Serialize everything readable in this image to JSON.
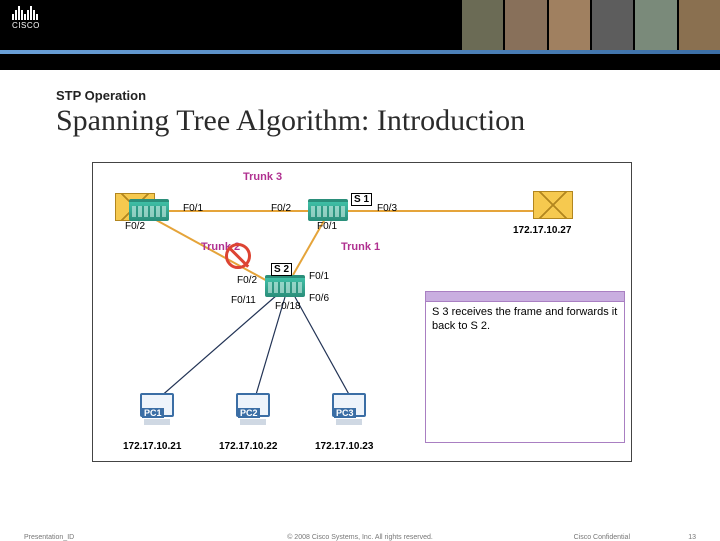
{
  "header": {
    "logo_text": "CISCO"
  },
  "super_title": "STP Operation",
  "title": "Spanning Tree Algorithm: Introduction",
  "diagram": {
    "trunks": {
      "t1": "Trunk 1",
      "t2": "Trunk 2",
      "t3": "Trunk 3"
    },
    "switches": {
      "s1": "S 1",
      "s2": "S 2"
    },
    "ports": {
      "s1_f01_left": "F0/1",
      "s1_f02_in": "F0/2",
      "s1_f01_down": "F0/1",
      "s1_f03": "F0/3",
      "s3_f02": "F0/2",
      "s2_f02": "F0/2",
      "s2_f01": "F0/1",
      "s2_f011": "F0/11",
      "s2_f018": "F0/18",
      "s2_f06": "F0/6"
    },
    "pcs": {
      "pc1": "PC1",
      "pc2": "PC2",
      "pc3": "PC3"
    },
    "ips": {
      "pc1": "172.17.10.21",
      "pc2": "172.17.10.22",
      "pc3": "172.17.10.23",
      "server": "172.17.10.27"
    },
    "note": "S 3 receives the frame and forwards it back to S 2."
  },
  "footer": {
    "left": "Presentation_ID",
    "center": "© 2008 Cisco Systems, Inc. All rights reserved.",
    "right": "Cisco Confidential",
    "page": "13"
  }
}
